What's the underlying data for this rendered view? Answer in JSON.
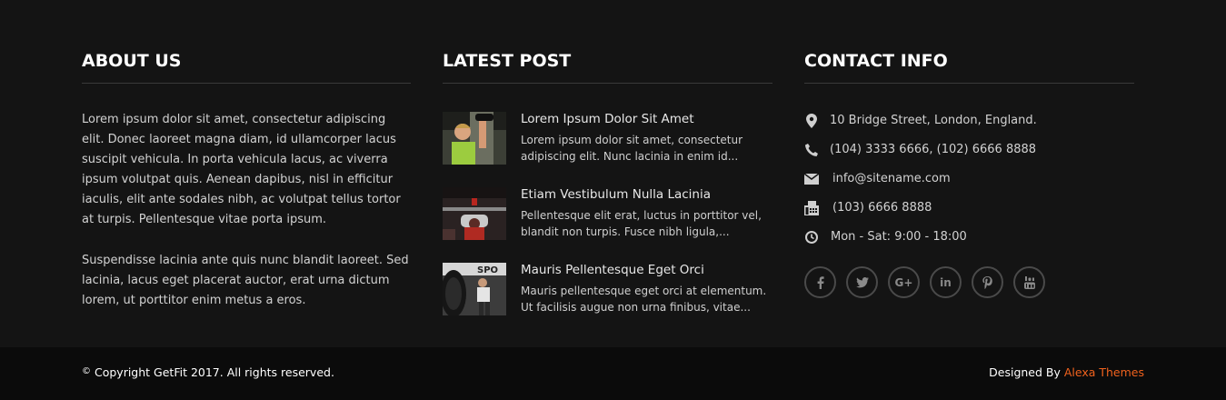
{
  "about": {
    "title": "ABOUT US",
    "paragraph1": "Lorem ipsum dolor sit amet, consectetur adipiscing elit. Donec laoreet magna diam, id ullamcorper lacus suscipit vehicula. In porta vehicula lacus, ac viverra ipsum volutpat quis. Aenean dapibus, nisl in efficitur iaculis, elit ante sodales nibh, ac volutpat tellus tortor at turpis. Pellentesque vitae porta ipsum.",
    "paragraph2": "Suspendisse lacinia ante quis nunc blandit laoreet. Sed lacinia, lacus eget placerat auctor, erat urna dictum lorem, ut porttitor enim metus a eros."
  },
  "latest_post": {
    "title": "LATEST POST",
    "posts": [
      {
        "title": "Lorem Ipsum Dolor Sit Amet",
        "excerpt": "Lorem ipsum dolor sit amet, consectetur adipiscing elit. Nunc lacinia in enim id...",
        "thumb_icon": "woman-dumbbell-photo"
      },
      {
        "title": "Etiam Vestibulum Nulla Lacinia",
        "excerpt": "Pellentesque elit erat, luctus in porttitor vel, blandit non turpis. Fusce nibh ligula,...",
        "thumb_icon": "bench-press-photo"
      },
      {
        "title": "Mauris Pellentesque Eget Orci",
        "excerpt": "Mauris pellentesque eget orci at elementum. Ut facilisis augue non urna finibus, vitae...",
        "thumb_icon": "tire-training-photo"
      }
    ]
  },
  "contact": {
    "title": "CONTACT INFO",
    "items": [
      {
        "icon": "map-marker-icon",
        "text": "10 Bridge Street, London, England."
      },
      {
        "icon": "phone-icon",
        "text": "(104) 3333 6666, (102) 6666 8888"
      },
      {
        "icon": "envelope-icon",
        "text": "info@sitename.com"
      },
      {
        "icon": "fax-icon",
        "text": "(103) 6666 8888"
      },
      {
        "icon": "clock-icon",
        "text": "Mon - Sat: 9:00 - 18:00"
      }
    ],
    "social": [
      {
        "icon": "facebook-icon",
        "glyph": "f"
      },
      {
        "icon": "twitter-icon",
        "glyph": "t"
      },
      {
        "icon": "google-plus-icon",
        "glyph": "G+"
      },
      {
        "icon": "linkedin-icon",
        "glyph": "in"
      },
      {
        "icon": "pinterest-icon",
        "glyph": "p"
      },
      {
        "icon": "youtube-icon",
        "glyph": "You"
      }
    ]
  },
  "bottom": {
    "copyright_symbol": "©",
    "copyright": "Copyright GetFit 2017. All rights reserved.",
    "designed_by": "Designed By ",
    "designer": "Alexa Themes"
  },
  "colors": {
    "background": "#141414",
    "bottom_bar": "#0b0b0b",
    "accent": "#f0621d",
    "rule": "#3a3a3a"
  }
}
